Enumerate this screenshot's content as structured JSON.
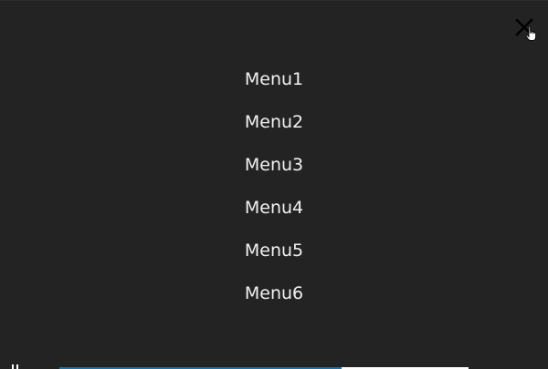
{
  "overlay": {
    "menu_items": [
      {
        "label": "Menu1"
      },
      {
        "label": "Menu2"
      },
      {
        "label": "Menu3"
      },
      {
        "label": "Menu4"
      },
      {
        "label": "Menu5"
      },
      {
        "label": "Menu6"
      }
    ],
    "close_icon": "close-icon"
  },
  "player": {
    "progress": 0.69,
    "elapsed": "",
    "duration": "",
    "icons": {
      "play_pause": "pause-icon",
      "volume": "volume-icon",
      "fullscreen": "fullscreen-icon"
    }
  },
  "colors": {
    "background": "#232324",
    "menu_text": "#f2f2f2",
    "progress_fill": "#1e6fa3",
    "progress_track": "#ffffff"
  }
}
